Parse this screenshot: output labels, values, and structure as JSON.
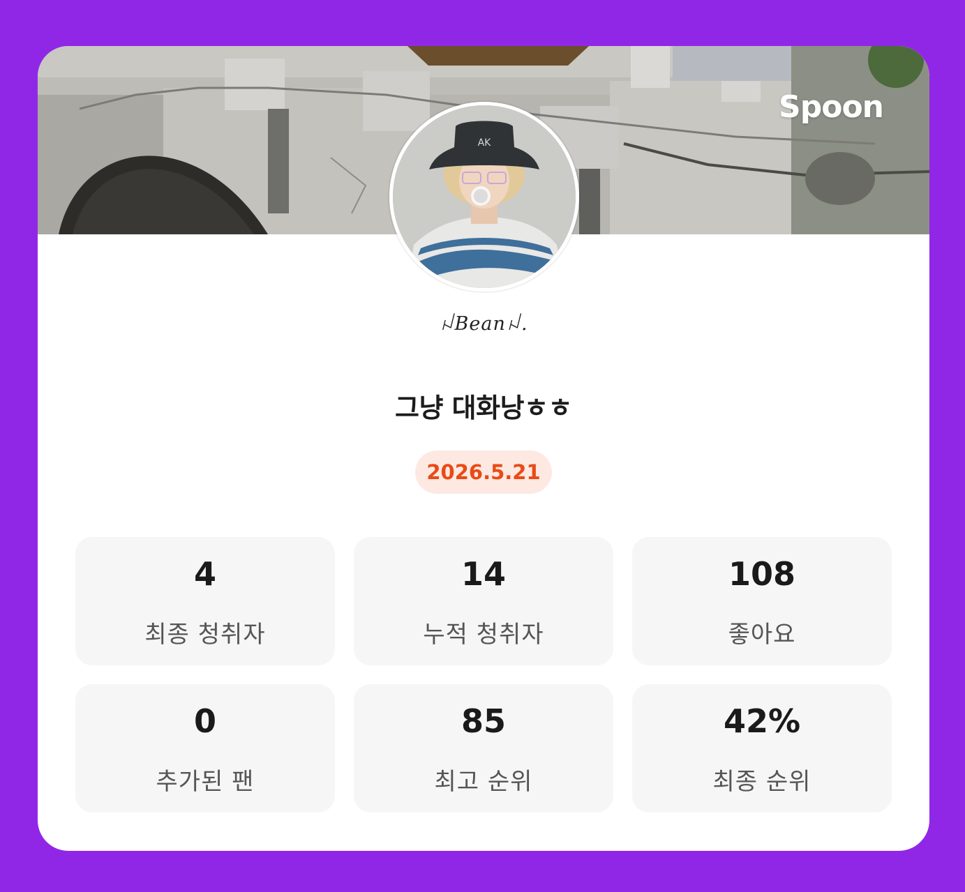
{
  "brand": {
    "logo_text": "Spoon"
  },
  "profile": {
    "nickname": "ꈤBeanꈤ."
  },
  "live": {
    "title": "그냥 대화낭ㅎㅎ",
    "date": "2026.5.21"
  },
  "stats": [
    {
      "value": "4",
      "label": "최종 청취자"
    },
    {
      "value": "14",
      "label": "누적 청취자"
    },
    {
      "value": "108",
      "label": "좋아요"
    },
    {
      "value": "0",
      "label": "추가된 팬"
    },
    {
      "value": "85",
      "label": "최고 순위"
    },
    {
      "value": "42%",
      "label": "최종 순위"
    }
  ],
  "colors": {
    "background": "#9127e6",
    "card": "#ffffff",
    "date_badge_bg": "#fde9e2",
    "date_text": "#ea4a16",
    "stat_tile": "#f6f6f6"
  }
}
